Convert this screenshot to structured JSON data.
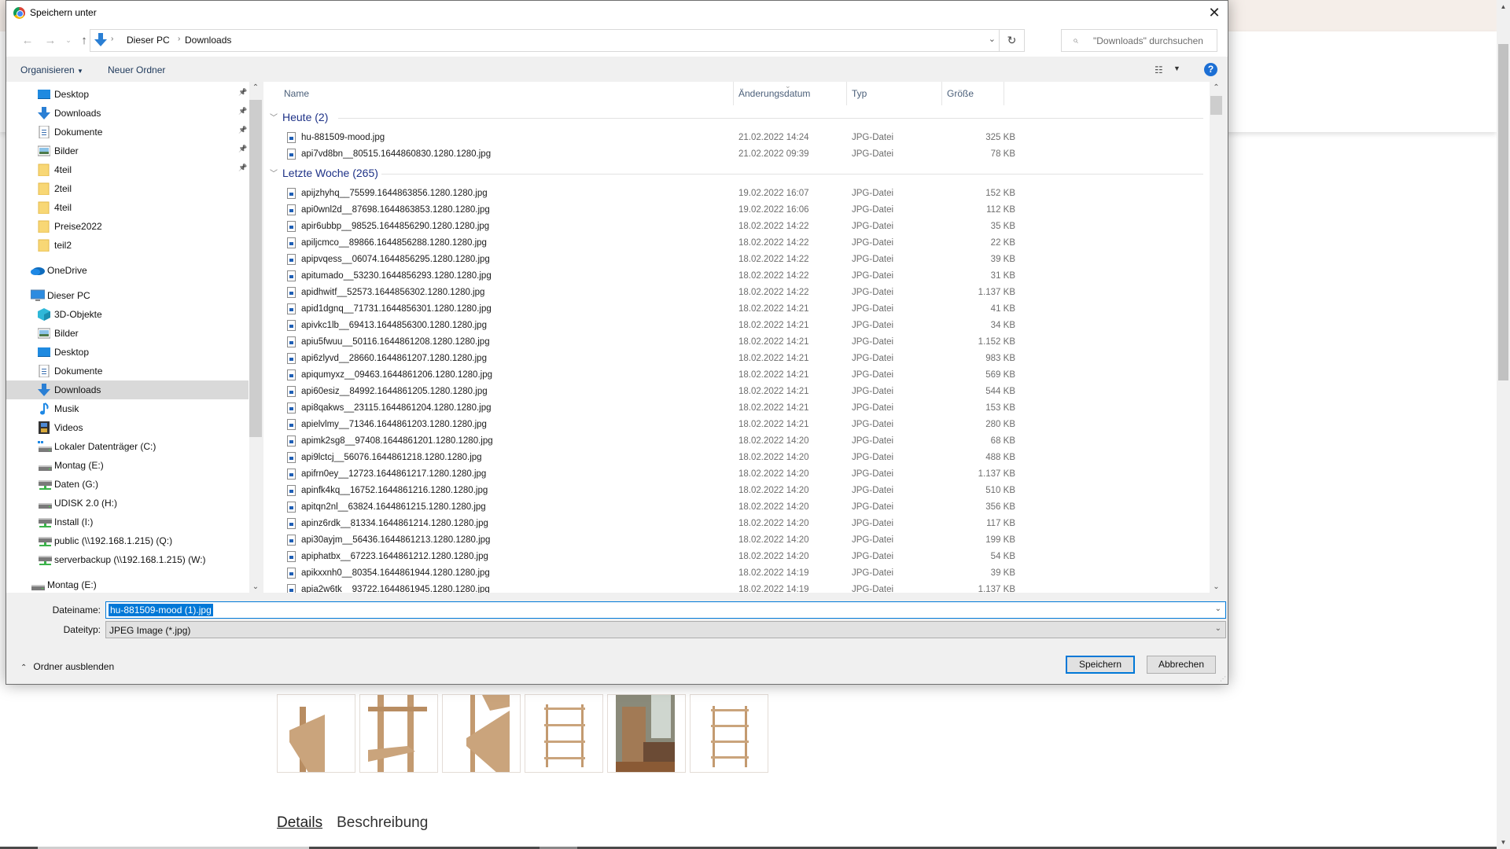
{
  "background_page": {
    "tabs": [
      {
        "label": "Details",
        "active": true
      },
      {
        "label": "Beschreibung",
        "active": false
      }
    ],
    "thumbnail_count": 6,
    "colors": {
      "top_band": "#f5eee9",
      "wood": "#c9a27a"
    }
  },
  "dialog": {
    "title": "Speichern unter",
    "close_icon": "close-icon",
    "nav": {
      "back_icon": "arrow-left-icon",
      "forward_icon": "arrow-right-icon",
      "recent_icon": "chevron-down-icon",
      "up_icon": "arrow-up-icon"
    },
    "address": {
      "crumbs": [
        "Dieser PC",
        "Downloads"
      ],
      "refresh_icon": "refresh-icon"
    },
    "search": {
      "placeholder": "\"Downloads\" durchsuchen"
    },
    "toolbar": {
      "organize": "Organisieren",
      "new_folder": "Neuer Ordner",
      "help": "?"
    },
    "sidebar": {
      "items": [
        {
          "label": "Desktop",
          "icon": "desktop-icon",
          "pinned": true,
          "indent": 1
        },
        {
          "label": "Downloads",
          "icon": "download-icon",
          "pinned": true,
          "indent": 1
        },
        {
          "label": "Dokumente",
          "icon": "documents-icon",
          "pinned": true,
          "indent": 1
        },
        {
          "label": "Bilder",
          "icon": "pictures-icon",
          "pinned": true,
          "indent": 1
        },
        {
          "label": "4teil",
          "icon": "folder-icon",
          "pinned": true,
          "indent": 1
        },
        {
          "label": "2teil",
          "icon": "folder-icon",
          "pinned": false,
          "indent": 1
        },
        {
          "label": "4teil",
          "icon": "folder-icon",
          "pinned": false,
          "indent": 1
        },
        {
          "label": "Preise2022",
          "icon": "folder-icon",
          "pinned": false,
          "indent": 1
        },
        {
          "label": "teil2",
          "icon": "folder-icon",
          "pinned": false,
          "indent": 1
        },
        {
          "label": "OneDrive",
          "icon": "onedrive-icon",
          "pinned": false,
          "indent": 0
        },
        {
          "label": "Dieser PC",
          "icon": "computer-icon",
          "pinned": false,
          "indent": 0
        },
        {
          "label": "3D-Objekte",
          "icon": "3d-objects-icon",
          "pinned": false,
          "indent": 1
        },
        {
          "label": "Bilder",
          "icon": "pictures-icon",
          "pinned": false,
          "indent": 1
        },
        {
          "label": "Desktop",
          "icon": "desktop-icon",
          "pinned": false,
          "indent": 1
        },
        {
          "label": "Dokumente",
          "icon": "documents-icon",
          "pinned": false,
          "indent": 1
        },
        {
          "label": "Downloads",
          "icon": "download-icon",
          "pinned": false,
          "indent": 1,
          "selected": true
        },
        {
          "label": "Musik",
          "icon": "music-icon",
          "pinned": false,
          "indent": 1
        },
        {
          "label": "Videos",
          "icon": "videos-icon",
          "pinned": false,
          "indent": 1
        },
        {
          "label": "Lokaler Datenträger (C:)",
          "icon": "system-drive-icon",
          "pinned": false,
          "indent": 1
        },
        {
          "label": "Montag (E:)",
          "icon": "drive-icon",
          "pinned": false,
          "indent": 1
        },
        {
          "label": "Daten (G:)",
          "icon": "network-drive-icon",
          "pinned": false,
          "indent": 1
        },
        {
          "label": "UDISK 2.0 (H:)",
          "icon": "drive-icon",
          "pinned": false,
          "indent": 1
        },
        {
          "label": "Install (I:)",
          "icon": "network-drive-icon",
          "pinned": false,
          "indent": 1
        },
        {
          "label": "public (\\\\192.168.1.215) (Q:)",
          "icon": "network-drive-icon",
          "pinned": false,
          "indent": 1
        },
        {
          "label": "serverbackup (\\\\192.168.1.215) (W:)",
          "icon": "network-drive-icon",
          "pinned": false,
          "indent": 1
        },
        {
          "label": "Montag (E:)",
          "icon": "drive-icon",
          "pinned": false,
          "indent": 0
        }
      ]
    },
    "filelist": {
      "columns": {
        "name": "Name",
        "date": "Änderungsdatum",
        "type": "Typ",
        "size": "Größe"
      },
      "groups": [
        {
          "title": "Heute (2)",
          "files": [
            {
              "name": "hu-881509-mood.jpg",
              "date": "21.02.2022 14:24",
              "type": "JPG-Datei",
              "size": "325 KB"
            },
            {
              "name": "api7vd8bn__80515.1644860830.1280.1280.jpg",
              "date": "21.02.2022 09:39",
              "type": "JPG-Datei",
              "size": "78 KB"
            }
          ]
        },
        {
          "title": "Letzte Woche (265)",
          "files": [
            {
              "name": "apijzhyhq__75599.1644863856.1280.1280.jpg",
              "date": "19.02.2022 16:07",
              "type": "JPG-Datei",
              "size": "152 KB"
            },
            {
              "name": "api0wnl2d__87698.1644863853.1280.1280.jpg",
              "date": "19.02.2022 16:06",
              "type": "JPG-Datei",
              "size": "112 KB"
            },
            {
              "name": "apir6ubbp__98525.1644856290.1280.1280.jpg",
              "date": "18.02.2022 14:22",
              "type": "JPG-Datei",
              "size": "35 KB"
            },
            {
              "name": "apiljcmco__89866.1644856288.1280.1280.jpg",
              "date": "18.02.2022 14:22",
              "type": "JPG-Datei",
              "size": "22 KB"
            },
            {
              "name": "apipvqess__06074.1644856295.1280.1280.jpg",
              "date": "18.02.2022 14:22",
              "type": "JPG-Datei",
              "size": "39 KB"
            },
            {
              "name": "apitumado__53230.1644856293.1280.1280.jpg",
              "date": "18.02.2022 14:22",
              "type": "JPG-Datei",
              "size": "31 KB"
            },
            {
              "name": "apidhwitf__52573.1644856302.1280.1280.jpg",
              "date": "18.02.2022 14:22",
              "type": "JPG-Datei",
              "size": "1.137 KB"
            },
            {
              "name": "apid1dgnq__71731.1644856301.1280.1280.jpg",
              "date": "18.02.2022 14:21",
              "type": "JPG-Datei",
              "size": "41 KB"
            },
            {
              "name": "apivkc1lb__69413.1644856300.1280.1280.jpg",
              "date": "18.02.2022 14:21",
              "type": "JPG-Datei",
              "size": "34 KB"
            },
            {
              "name": "apiu5fwuu__50116.1644861208.1280.1280.jpg",
              "date": "18.02.2022 14:21",
              "type": "JPG-Datei",
              "size": "1.152 KB"
            },
            {
              "name": "api6zlyvd__28660.1644861207.1280.1280.jpg",
              "date": "18.02.2022 14:21",
              "type": "JPG-Datei",
              "size": "983 KB"
            },
            {
              "name": "apiqumyxz__09463.1644861206.1280.1280.jpg",
              "date": "18.02.2022 14:21",
              "type": "JPG-Datei",
              "size": "569 KB"
            },
            {
              "name": "api60esiz__84992.1644861205.1280.1280.jpg",
              "date": "18.02.2022 14:21",
              "type": "JPG-Datei",
              "size": "544 KB"
            },
            {
              "name": "api8qakws__23115.1644861204.1280.1280.jpg",
              "date": "18.02.2022 14:21",
              "type": "JPG-Datei",
              "size": "153 KB"
            },
            {
              "name": "apielvlmy__71346.1644861203.1280.1280.jpg",
              "date": "18.02.2022 14:21",
              "type": "JPG-Datei",
              "size": "280 KB"
            },
            {
              "name": "apimk2sg8__97408.1644861201.1280.1280.jpg",
              "date": "18.02.2022 14:20",
              "type": "JPG-Datei",
              "size": "68 KB"
            },
            {
              "name": "api9lctcj__56076.1644861218.1280.1280.jpg",
              "date": "18.02.2022 14:20",
              "type": "JPG-Datei",
              "size": "488 KB"
            },
            {
              "name": "apifrn0ey__12723.1644861217.1280.1280.jpg",
              "date": "18.02.2022 14:20",
              "type": "JPG-Datei",
              "size": "1.137 KB"
            },
            {
              "name": "apinfk4kq__16752.1644861216.1280.1280.jpg",
              "date": "18.02.2022 14:20",
              "type": "JPG-Datei",
              "size": "510 KB"
            },
            {
              "name": "apitqn2nl__63824.1644861215.1280.1280.jpg",
              "date": "18.02.2022 14:20",
              "type": "JPG-Datei",
              "size": "356 KB"
            },
            {
              "name": "apinz6rdk__81334.1644861214.1280.1280.jpg",
              "date": "18.02.2022 14:20",
              "type": "JPG-Datei",
              "size": "117 KB"
            },
            {
              "name": "api30ayjm__56436.1644861213.1280.1280.jpg",
              "date": "18.02.2022 14:20",
              "type": "JPG-Datei",
              "size": "199 KB"
            },
            {
              "name": "apiphatbx__67223.1644861212.1280.1280.jpg",
              "date": "18.02.2022 14:20",
              "type": "JPG-Datei",
              "size": "54 KB"
            },
            {
              "name": "apikxxnh0__80354.1644861944.1280.1280.jpg",
              "date": "18.02.2022 14:19",
              "type": "JPG-Datei",
              "size": "39 KB"
            },
            {
              "name": "apia2w6tk__93722.1644861945.1280.1280.jpg",
              "date": "18.02.2022 14:19",
              "type": "JPG-Datei",
              "size": "1.137 KB"
            }
          ]
        }
      ]
    },
    "filename": {
      "label": "Dateiname:",
      "value": "hu-881509-mood (1).jpg"
    },
    "filetype": {
      "label": "Dateityp:",
      "value": "JPEG Image (*.jpg)"
    },
    "hide_folders": "Ordner ausblenden",
    "save_button": "Speichern",
    "cancel_button": "Abbrechen",
    "colors": {
      "accent": "#0078d7",
      "group_title": "#1e3287",
      "selected_nav": "#d9d9d9"
    }
  }
}
